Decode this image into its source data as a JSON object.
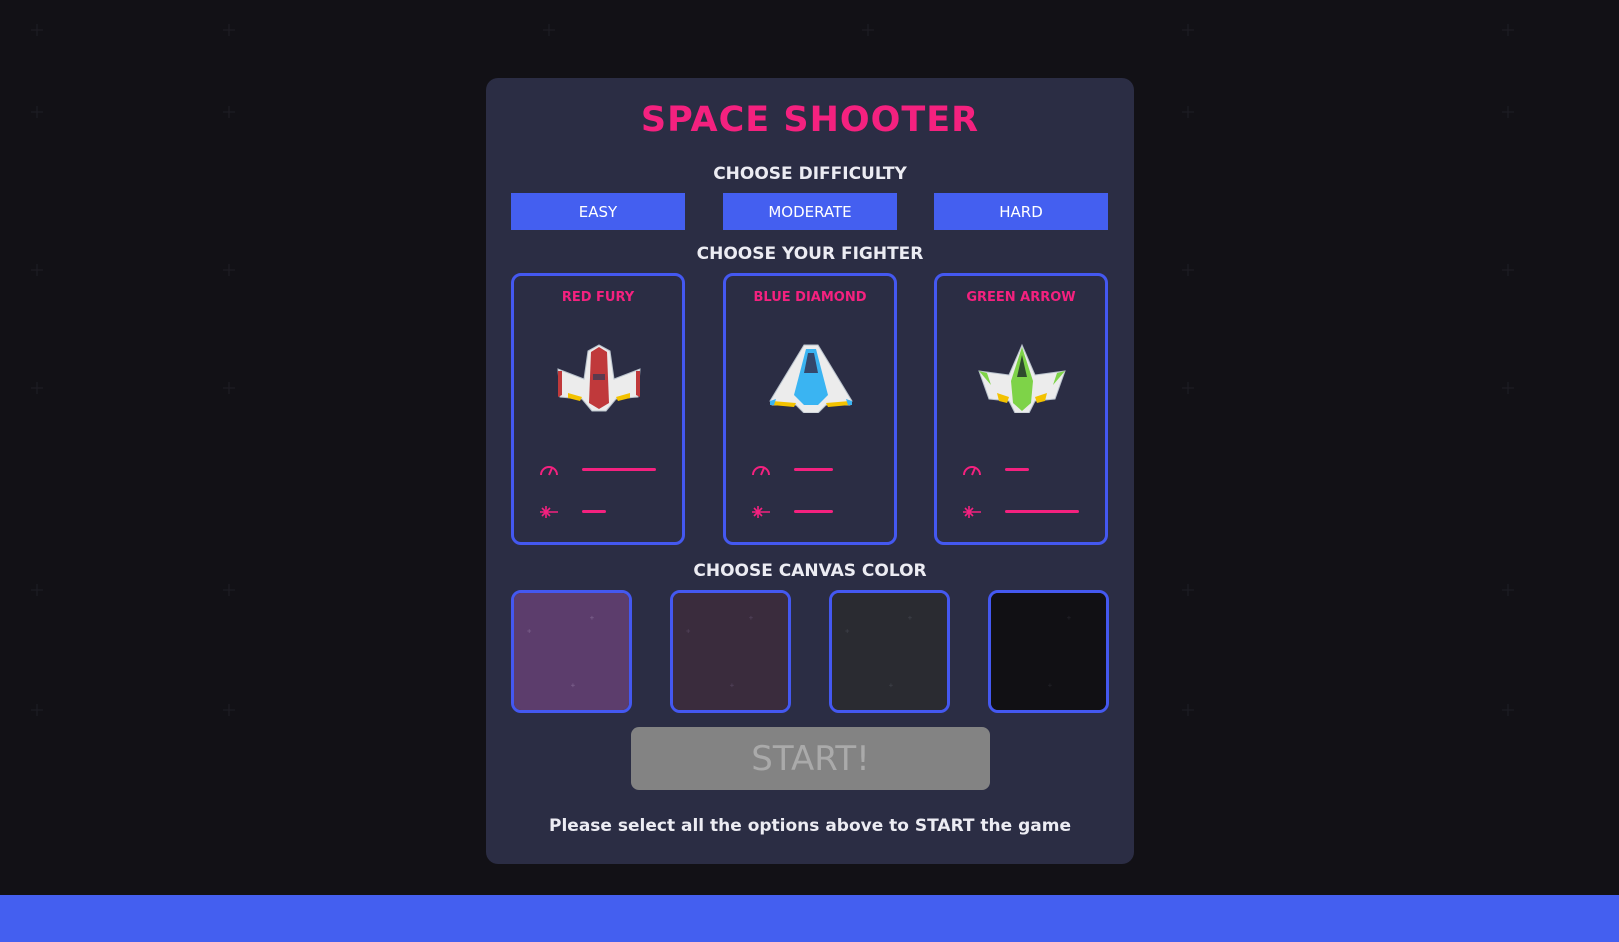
{
  "app": {
    "title": "SPACE SHOOTER"
  },
  "difficulty": {
    "heading": "CHOOSE DIFFICULTY",
    "options": [
      {
        "label": "EASY"
      },
      {
        "label": "MODERATE"
      },
      {
        "label": "HARD"
      }
    ]
  },
  "fighters": {
    "heading": "CHOOSE YOUR FIGHTER",
    "stat_icons": [
      "speedometer-icon",
      "laser-icon"
    ],
    "items": [
      {
        "name": "RED FURY",
        "color": "#c0393b",
        "speed": 1.0,
        "firepower": 0.33
      },
      {
        "name": "BLUE DIAMOND",
        "color": "#3ab4f2",
        "speed": 0.53,
        "firepower": 0.53
      },
      {
        "name": "GREEN ARROW",
        "color": "#7ed348",
        "speed": 0.33,
        "firepower": 1.0
      }
    ]
  },
  "canvas": {
    "heading": "CHOOSE CANVAS COLOR",
    "colors": [
      "#5c3d6c",
      "#3a2c3d",
      "#2a2b31",
      "#111014"
    ]
  },
  "colors": {
    "accent": "#f4217f",
    "primary": "#445ff0",
    "panel": "#2b2d44",
    "background": "#121116"
  },
  "start": {
    "label": "START!",
    "enabled": false
  },
  "hint": "Please select all the options above to START the game"
}
